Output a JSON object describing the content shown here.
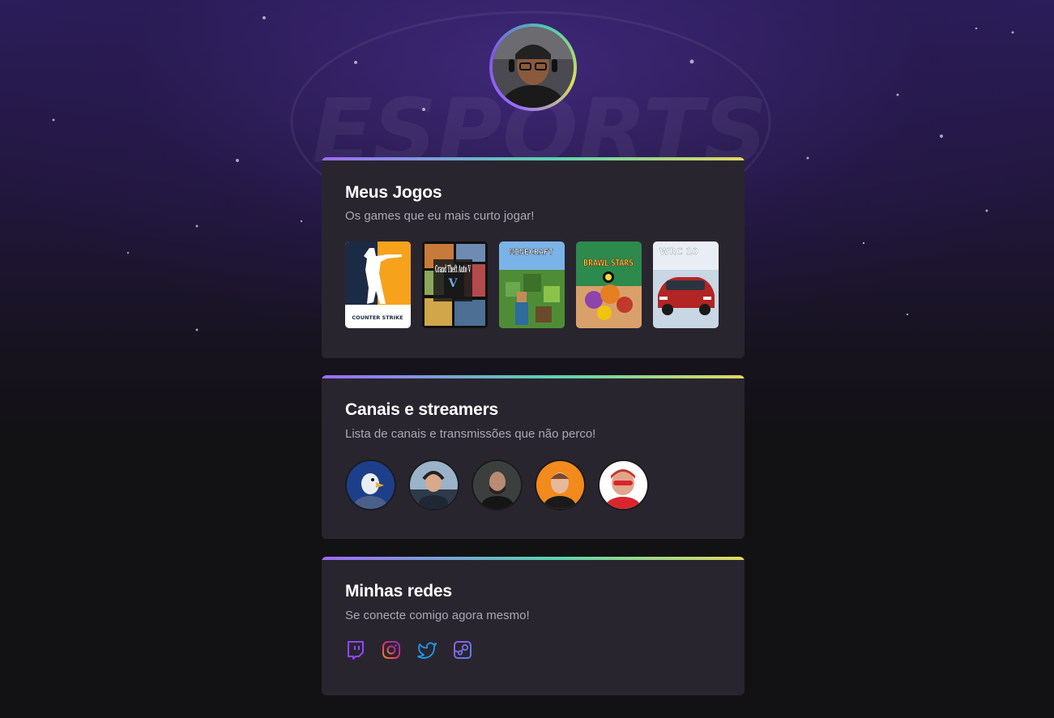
{
  "profile": {
    "avatar_icon": "user-avatar"
  },
  "games_section": {
    "title": "Meus Jogos",
    "subtitle": "Os games que eu mais curto jogar!",
    "games": [
      {
        "name": "Counter-Strike",
        "cover_text": "COUNTER STRIKE",
        "icon": "counter-strike-cover"
      },
      {
        "name": "Grand Theft Auto V",
        "cover_text": "Grand Theft Auto V",
        "icon": "gta-v-cover"
      },
      {
        "name": "Minecraft",
        "cover_text": "MINECRAFT",
        "icon": "minecraft-cover"
      },
      {
        "name": "Brawl Stars",
        "cover_text": "BRAWL STARS",
        "icon": "brawl-stars-cover"
      },
      {
        "name": "WRC 10",
        "cover_text": "WRC 10",
        "icon": "wrc-10-cover"
      }
    ]
  },
  "streamers_section": {
    "title": "Canais e streamers",
    "subtitle": "Lista de canais e transmissões que não perco!",
    "streamers": [
      {
        "icon": "streamer-avatar-1",
        "color": "#1d3f8a"
      },
      {
        "icon": "streamer-avatar-2",
        "color": "#5b7fa8"
      },
      {
        "icon": "streamer-avatar-3",
        "color": "#2e2e2e"
      },
      {
        "icon": "streamer-avatar-4",
        "color": "#f28a1c"
      },
      {
        "icon": "streamer-avatar-5",
        "color": "#d8262c"
      }
    ]
  },
  "socials_section": {
    "title": "Minhas redes",
    "subtitle": "Se conecte comigo agora mesmo!",
    "links": [
      {
        "icon": "twitch-icon",
        "color": "#9146ff"
      },
      {
        "icon": "instagram-icon",
        "color": "#e1306c"
      },
      {
        "icon": "twitter-icon",
        "color": "#1d9bf0"
      },
      {
        "icon": "steam-icon",
        "color": "#8f5fe8"
      }
    ]
  },
  "colors": {
    "background": "#121214",
    "card": "#29252f",
    "accent_gradient": [
      "#9f6aff",
      "#59d4b0",
      "#e3d960"
    ],
    "title": "#ffffff",
    "subtitle": "#a8a8b3"
  }
}
